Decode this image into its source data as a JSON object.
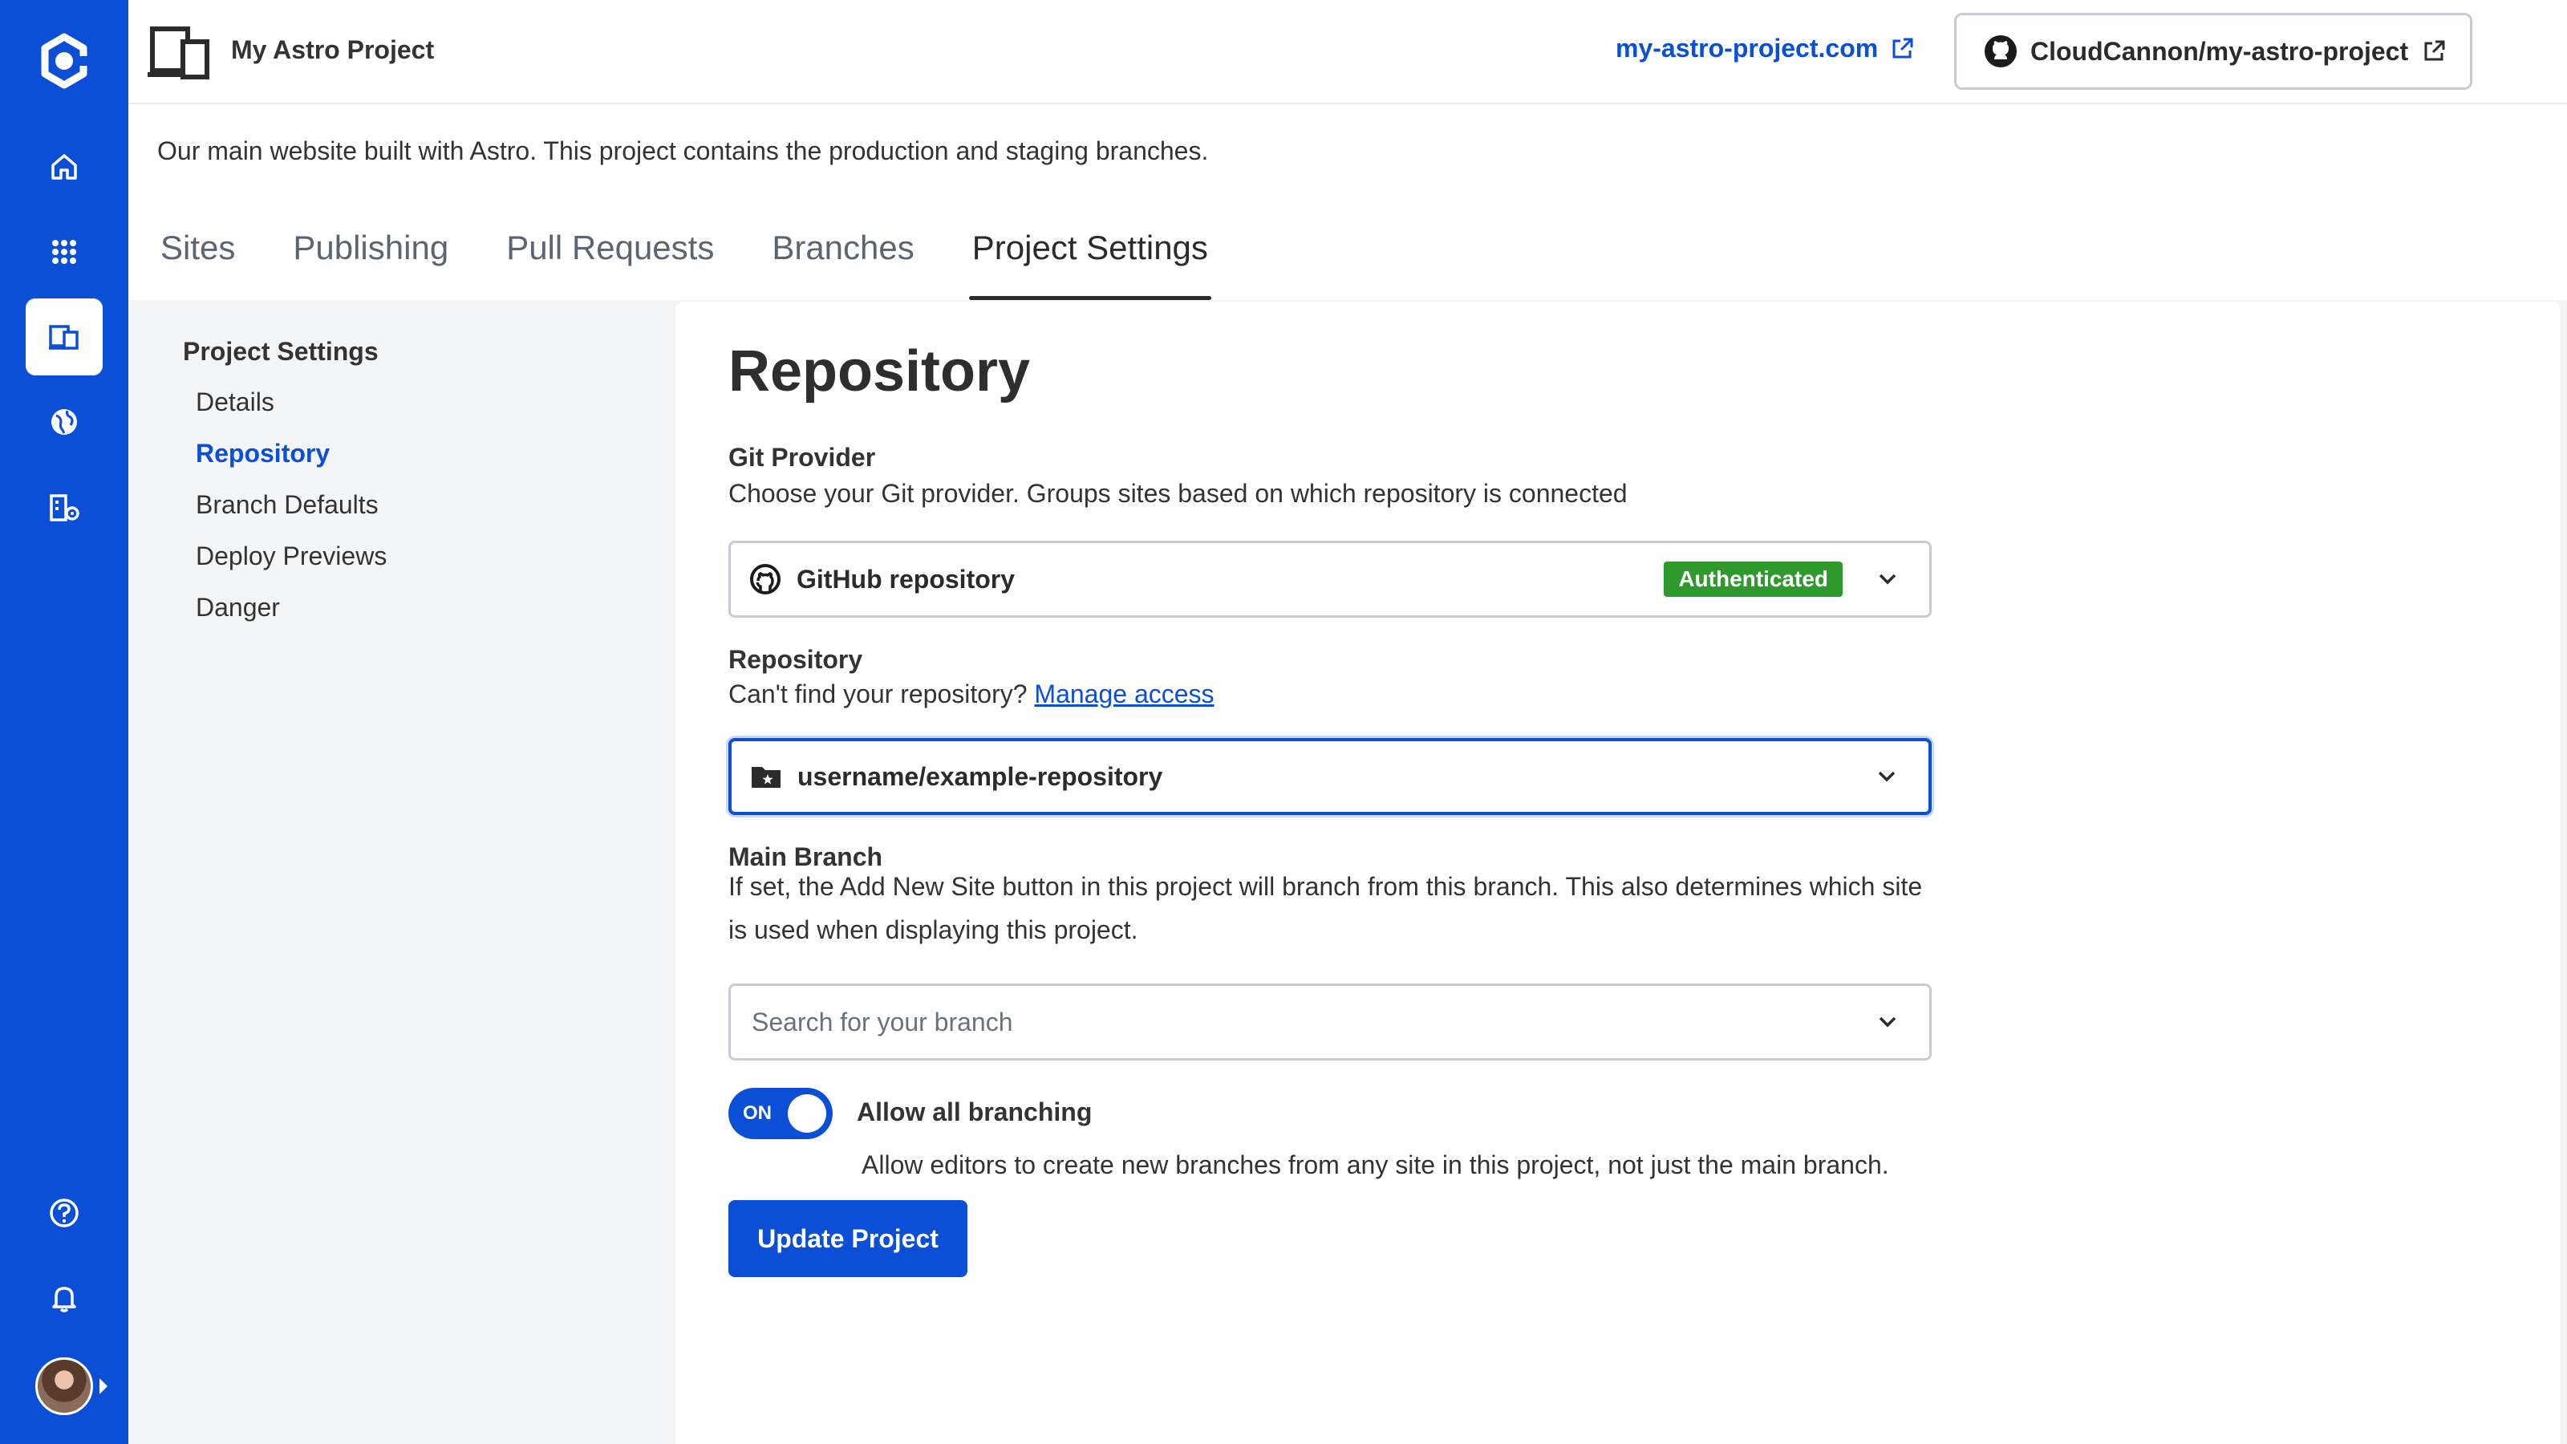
{
  "header": {
    "project_name": "My Astro Project",
    "site_link": "my-astro-project.com",
    "repo_button": "CloudCannon/my-astro-project"
  },
  "project": {
    "description": "Our main website built with Astro. This project contains the production and staging branches."
  },
  "tabs": [
    {
      "label": "Sites"
    },
    {
      "label": "Publishing"
    },
    {
      "label": "Pull Requests"
    },
    {
      "label": "Branches"
    },
    {
      "label": "Project Settings",
      "active": true
    }
  ],
  "settings_nav": {
    "title": "Project Settings",
    "items": [
      {
        "label": "Details"
      },
      {
        "label": "Repository",
        "active": true
      },
      {
        "label": "Branch Defaults"
      },
      {
        "label": "Deploy Previews"
      },
      {
        "label": "Danger"
      }
    ]
  },
  "form": {
    "heading": "Repository",
    "git_provider": {
      "label": "Git Provider",
      "help": "Choose your Git provider. Groups sites based on which repository is connected",
      "value": "GitHub repository",
      "badge": "Authenticated"
    },
    "repository": {
      "label": "Repository",
      "help": "Can't find your repository?",
      "help_link": "Manage access",
      "value": "username/example-repository"
    },
    "main_branch": {
      "label": "Main Branch",
      "help": "If set, the Add New Site button in this project will branch from this branch. This also determines which site is used when displaying this project.",
      "placeholder": "Search for your branch"
    },
    "allow_branching": {
      "state": "ON",
      "label": "Allow all branching",
      "help": "Allow editors to create new branches from any site in this project, not just the main branch."
    },
    "submit_label": "Update Project"
  },
  "colors": {
    "brand": "#0a4fd6",
    "badge_green": "#2e9a2e"
  },
  "icons": {
    "rail": [
      "home-icon",
      "apps-grid-icon",
      "projects-icon",
      "globe-icon",
      "organization-settings-icon",
      "help-icon",
      "bell-icon"
    ]
  }
}
